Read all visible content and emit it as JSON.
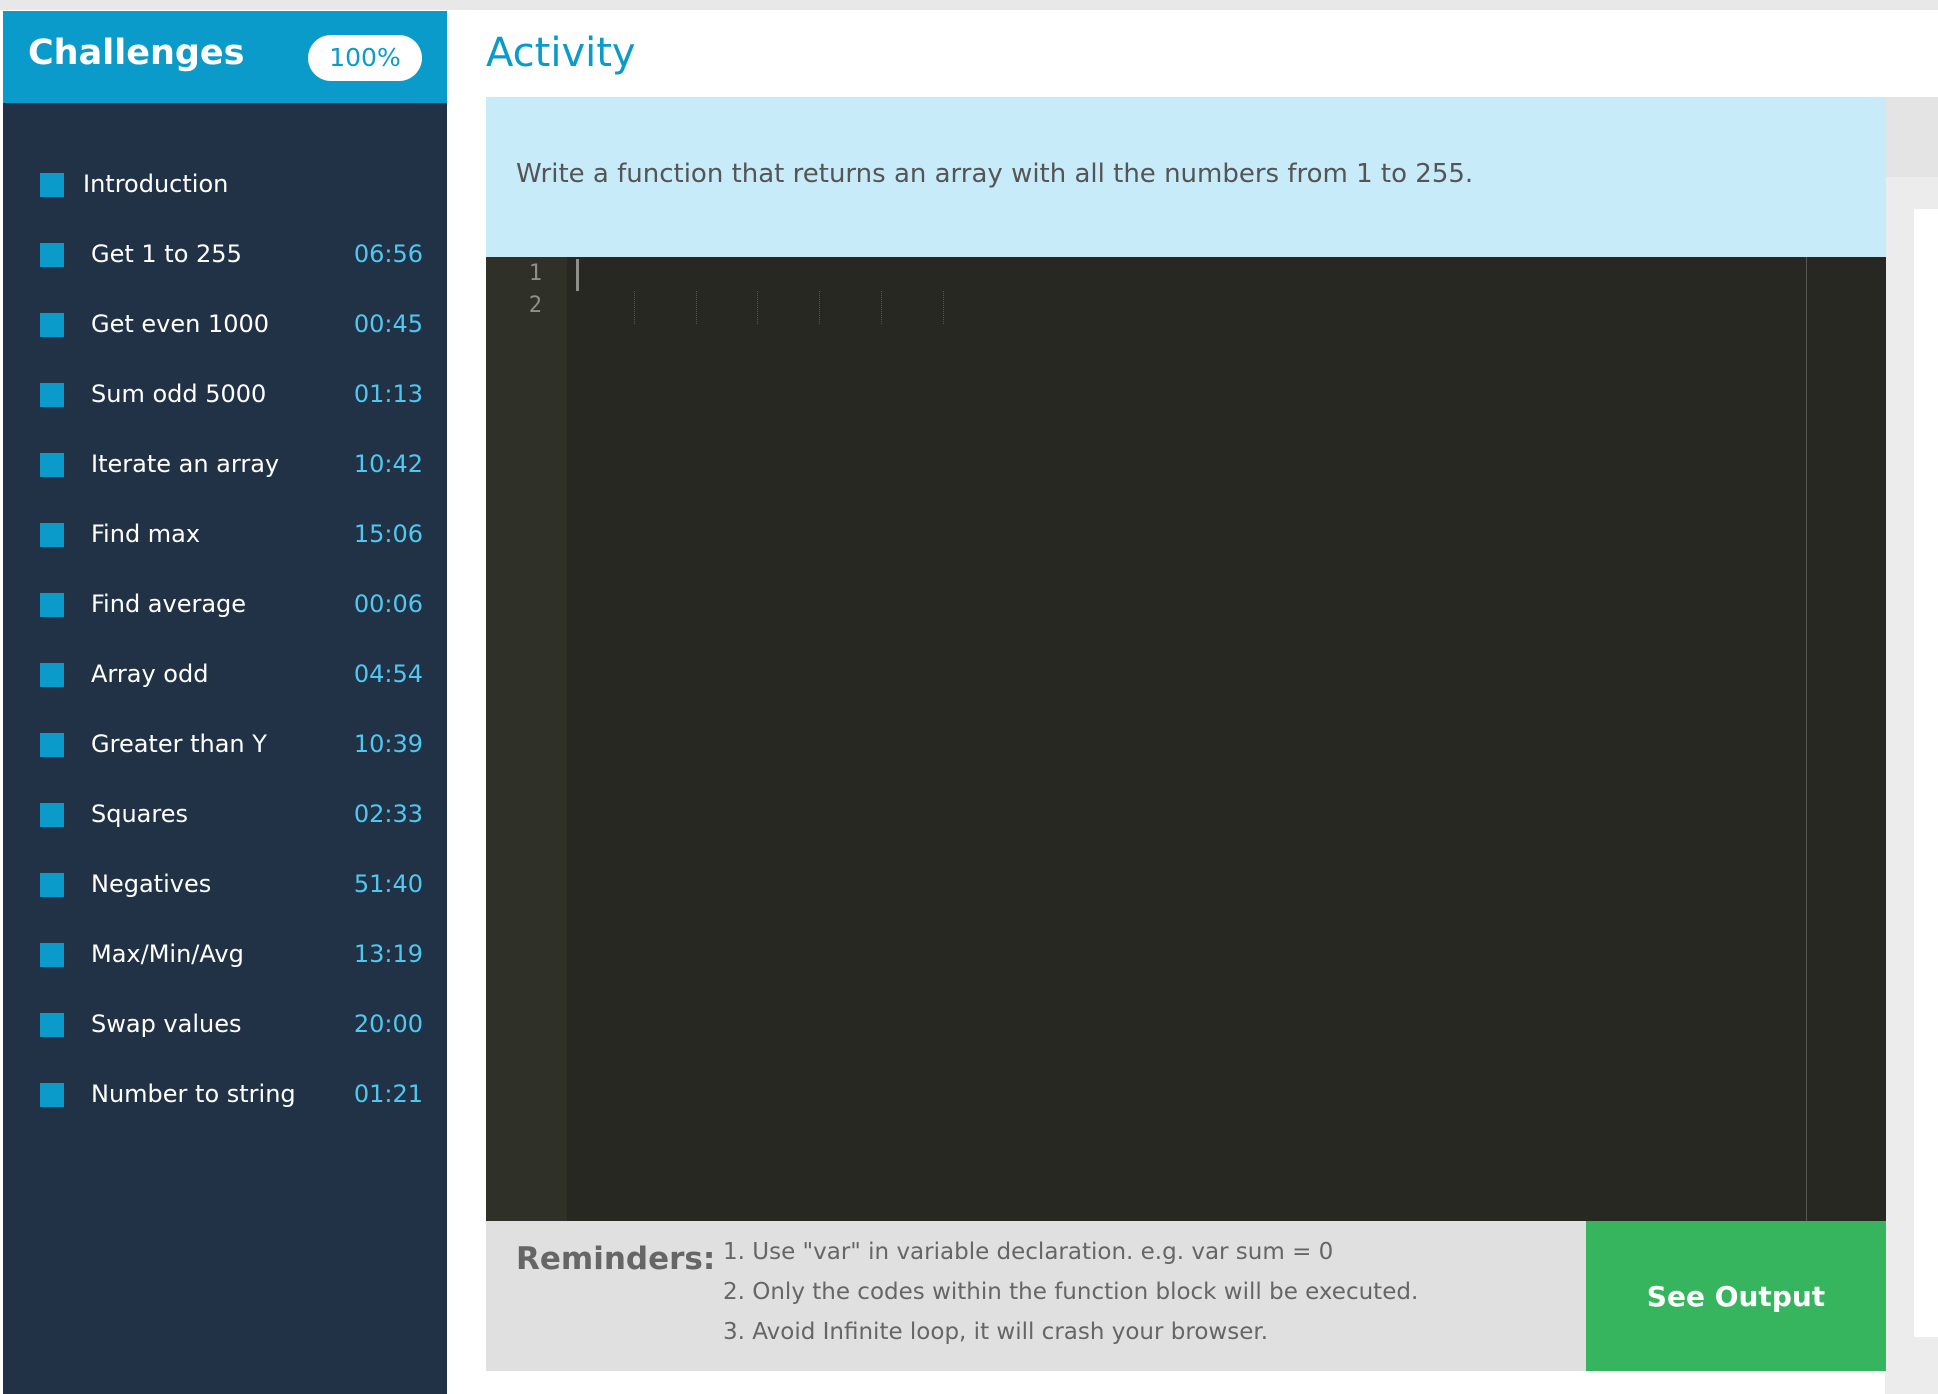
{
  "sidebar": {
    "title": "Challenges",
    "progress": "100%",
    "items": [
      {
        "label": "Introduction",
        "time": ""
      },
      {
        "label": "Get 1 to 255",
        "time": "06:56"
      },
      {
        "label": "Get even 1000",
        "time": "00:45"
      },
      {
        "label": "Sum odd 5000",
        "time": "01:13"
      },
      {
        "label": "Iterate an array",
        "time": "10:42"
      },
      {
        "label": "Find max",
        "time": "15:06"
      },
      {
        "label": "Find average",
        "time": "00:06"
      },
      {
        "label": "Array odd",
        "time": "04:54"
      },
      {
        "label": "Greater than Y",
        "time": "10:39"
      },
      {
        "label": "Squares",
        "time": "02:33"
      },
      {
        "label": "Negatives",
        "time": "51:40"
      },
      {
        "label": "Max/Min/Avg",
        "time": "13:19"
      },
      {
        "label": "Swap values",
        "time": "20:00"
      },
      {
        "label": "Number to string",
        "time": "01:21"
      }
    ]
  },
  "main": {
    "title": "Activity",
    "prompt": "Write a function that returns an array with all the numbers from 1 to 255."
  },
  "editor": {
    "line_numbers": [
      "1",
      "2"
    ]
  },
  "reminders": {
    "label": "Reminders:",
    "lines": [
      "1. Use \"var\" in variable declaration. e.g. var sum = 0",
      "2. Only the codes within the function block will be executed.",
      "3. Avoid Infinite loop, it will crash your browser."
    ]
  },
  "actions": {
    "see_output_label": "See Output"
  },
  "colors": {
    "accent": "#0a9bcb",
    "sidebar_bg": "#213246",
    "time_text": "#4fc8f0",
    "prompt_bg": "#c8ebf9",
    "editor_bg": "#272822",
    "output_button": "#36b45e"
  }
}
